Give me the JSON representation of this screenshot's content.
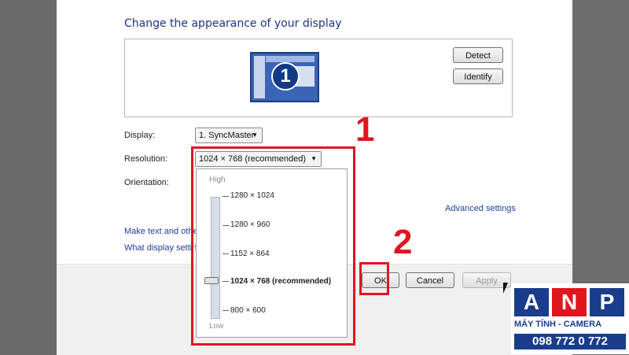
{
  "heading": "Change the appearance of your display",
  "monitor_number": "1",
  "buttons": {
    "detect": "Detect",
    "identify": "Identify",
    "ok": "OK",
    "cancel": "Cancel",
    "apply": "Apply"
  },
  "form": {
    "display_label": "Display:",
    "display_value": "1. SyncMaster",
    "resolution_label": "Resolution:",
    "resolution_value": "1024 × 768 (recommended)",
    "orientation_label": "Orientation:"
  },
  "links": {
    "advanced": "Advanced settings",
    "make_text": "Make text and other",
    "what_display": "What display settin"
  },
  "dropdown": {
    "high": "High",
    "low": "Low",
    "options": [
      "1280 × 1024",
      "1280 × 960",
      "1152 × 864",
      "1024 × 768 (recommended)",
      "800 × 600"
    ],
    "selected": "1024 × 768 (recommended)"
  },
  "annotations": {
    "step1": "1",
    "step2": "2"
  },
  "logo": {
    "letters": [
      "A",
      "N",
      "P"
    ],
    "tagline": "MÁY TÍNH - CAMERA",
    "phone": "098 772 0 772",
    "colors": [
      "#1a3c8c",
      "#e0161f"
    ]
  }
}
